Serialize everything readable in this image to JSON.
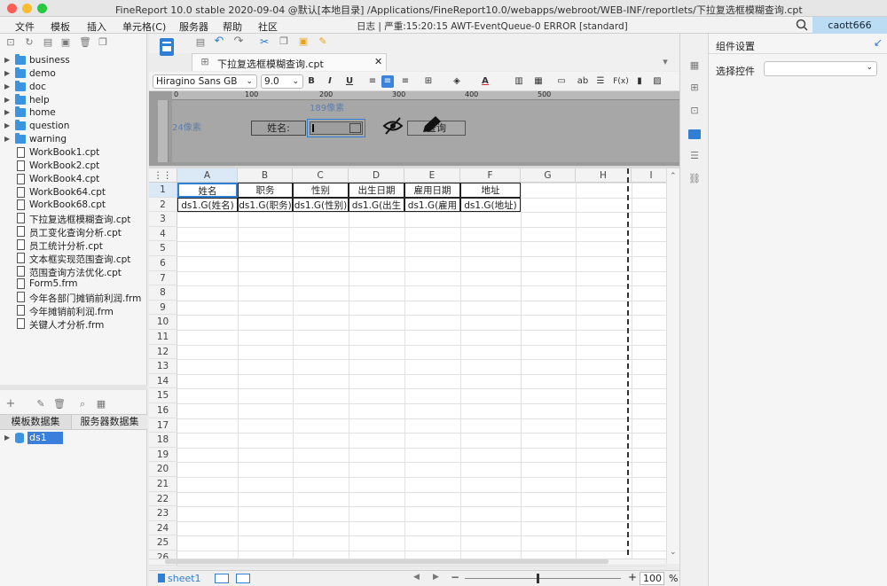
{
  "window": {
    "title": "FineReport 10.0 stable 2020-09-04 @默认[本地目录]   /Applications/FineReport10.0/webapps/webroot/WEB-INF/reportlets/下拉复选框模糊查询.cpt"
  },
  "menubar": {
    "items": [
      "文件",
      "模板",
      "插入",
      "单元格(C)",
      "服务器",
      "帮助",
      "社区"
    ],
    "log": "日志 | 严重:15:20:15 AWT-EventQueue-0 ERROR [standard]",
    "user": "caott666"
  },
  "tree": {
    "folders": [
      "business",
      "demo",
      "doc",
      "help",
      "home",
      "question",
      "warning"
    ],
    "files": [
      "WorkBook1.cpt",
      "WorkBook2.cpt",
      "WorkBook4.cpt",
      "WorkBook64.cpt",
      "WorkBook68.cpt",
      "下拉复选框模糊查询.cpt",
      "员工变化查询分析.cpt",
      "员工统计分析.cpt",
      "文本框实现范围查询.cpt",
      "范围查询方法优化.cpt",
      "Form5.frm",
      "今年各部门摊销前利润.frm",
      "今年摊销前利润.frm",
      "关键人才分析.frm"
    ]
  },
  "datasets": {
    "tab_template": "模板数据集",
    "tab_server": "服务器数据集",
    "items": [
      "ds1"
    ]
  },
  "document": {
    "tab_title": "下拉复选框模糊查询.cpt"
  },
  "format": {
    "font": "Hiragino Sans GB",
    "size": "9.0",
    "bold": "B",
    "italic": "I",
    "underline": "U",
    "abc": "ab",
    "fx": "F(x)"
  },
  "param_pane": {
    "ruler_ticks": [
      "0",
      "100",
      "200",
      "300",
      "400",
      "500"
    ],
    "width_hint": "189像素",
    "height_hint": "24像素",
    "label": "姓名:",
    "query_button": "查询"
  },
  "grid": {
    "columns": [
      "A",
      "B",
      "C",
      "D",
      "E",
      "F",
      "G",
      "H",
      "I"
    ],
    "rows": [
      "1",
      "2",
      "3",
      "4",
      "5",
      "6",
      "7",
      "8",
      "9",
      "10",
      "11",
      "12",
      "13",
      "14",
      "15",
      "16",
      "17",
      "18",
      "19",
      "20",
      "21",
      "22",
      "23",
      "24",
      "25",
      "26"
    ],
    "row1": [
      "姓名",
      "职务",
      "性别",
      "出生日期",
      "雇用日期",
      "地址"
    ],
    "row2": [
      "ds1.G(姓名)",
      "ds1.G(职务)",
      "ds1.G(性别)",
      "ds1.G(出生",
      "ds1.G(雇用",
      "ds1.G(地址)"
    ]
  },
  "bottom": {
    "sheet": "sheet1",
    "zoom": "100",
    "percent": "%"
  },
  "props": {
    "title": "组件设置",
    "widget_label": "选择控件"
  },
  "colors": {
    "accent": "#2f7fd5",
    "folder": "#3b94e0",
    "selection": "#bcdcf4"
  }
}
